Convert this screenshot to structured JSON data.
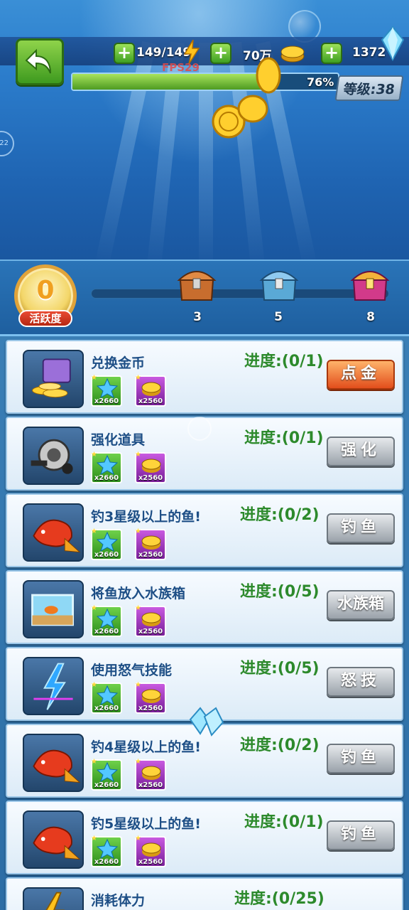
{
  "hud": {
    "energy": "149/149",
    "gold": "70万",
    "diamonds": "1372",
    "fps": "FPS29",
    "xp_percent": "76%",
    "xp_fraction": 0.76,
    "level": "等级:38"
  },
  "activity": {
    "points": "0",
    "label": "活跃度",
    "milestones": [
      "3",
      "5",
      "8"
    ]
  },
  "tasks": [
    {
      "title": "兑换金币",
      "progress": "进度:(0/1)",
      "button": "点金",
      "icon": "gold-treasure-icon",
      "star_reward": "x2660",
      "coin_reward": "x2560"
    },
    {
      "title": "强化道具",
      "progress": "进度:(0/1)",
      "button": "强化",
      "icon": "fishing-reel-icon",
      "star_reward": "x2660",
      "coin_reward": "x2560"
    },
    {
      "title": "钓3星级以上的鱼!",
      "progress": "进度:(0/2)",
      "button": "钓鱼",
      "icon": "red-fish-icon",
      "star_reward": "x2660",
      "coin_reward": "x2560"
    },
    {
      "title": "将鱼放入水族箱",
      "progress": "进度:(0/5)",
      "button": "水族箱",
      "icon": "aquarium-icon",
      "star_reward": "x2660",
      "coin_reward": "x2560"
    },
    {
      "title": "使用怒气技能",
      "progress": "进度:(0/5)",
      "button": "怒技",
      "icon": "rage-skill-icon",
      "star_reward": "x2660",
      "coin_reward": "x2560"
    },
    {
      "title": "钓4星级以上的鱼!",
      "progress": "进度:(0/2)",
      "button": "钓鱼",
      "icon": "red-fish-icon",
      "star_reward": "x2660",
      "coin_reward": "x2560"
    },
    {
      "title": "钓5星级以上的鱼!",
      "progress": "进度:(0/1)",
      "button": "钓鱼",
      "icon": "red-fish-icon",
      "star_reward": "x2660",
      "coin_reward": "x2560"
    },
    {
      "title": "消耗体力",
      "progress": "进度:(0/25)",
      "button": "",
      "icon": "energy-icon",
      "star_reward": "",
      "coin_reward": ""
    }
  ],
  "colors": {
    "progress_green": "#2d8a2c",
    "title_blue": "#1e4f86",
    "primary_button": "#e24e1c",
    "secondary_button": "#9aa2aa"
  }
}
